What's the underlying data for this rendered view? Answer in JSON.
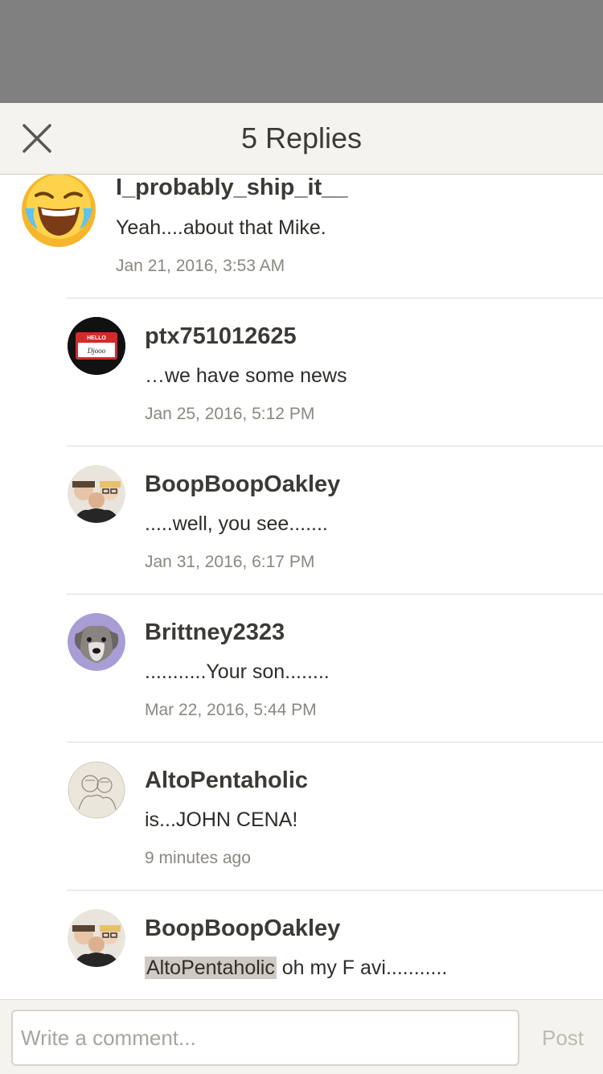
{
  "header": {
    "title": "5 Replies",
    "close_icon": "close-icon"
  },
  "parent": {
    "username": "I_probably_ship_it__",
    "text": "Yeah....about that Mike.",
    "time": "Jan 21, 2016, 3:53 AM",
    "avatar": "laughing-crying-emoji-avatar"
  },
  "replies": [
    {
      "username": "ptx751012625",
      "text": "…we have some news",
      "time": "Jan 25, 2016, 5:12 PM",
      "avatar": "hello-name-tag-avatar",
      "badge_text": "HELLO",
      "badge_name": "Djooo"
    },
    {
      "username": "BoopBoopOakley",
      "text": ".....well, you see.......",
      "time": "Jan 31, 2016, 6:17 PM",
      "avatar": "group-photo-avatar"
    },
    {
      "username": "Brittney2323",
      "text": "...........Your son........",
      "time": "Mar 22, 2016, 5:44 PM",
      "avatar": "dog-photo-avatar"
    },
    {
      "username": "AltoPentaholic",
      "text": "is...JOHN CENA!",
      "time": "9 minutes ago",
      "avatar": "sketch-drawing-avatar"
    },
    {
      "username": "BoopBoopOakley",
      "mention": "AltoPentaholic",
      "text": " oh my F avi...........",
      "avatar": "group-photo-avatar"
    }
  ],
  "footer": {
    "placeholder": "Write a comment...",
    "post_label": "Post"
  }
}
